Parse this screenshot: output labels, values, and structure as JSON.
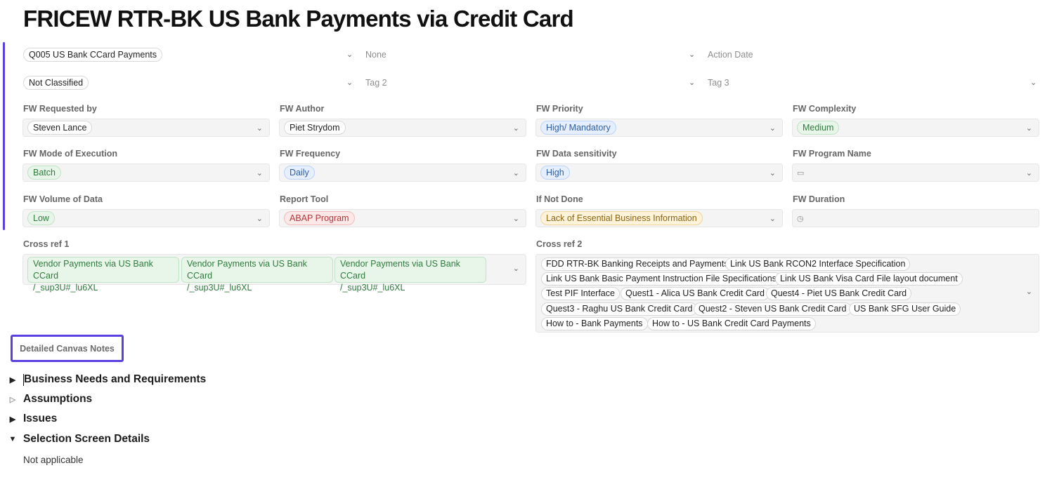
{
  "page": {
    "title": "FRICEW RTR-BK US Bank Payments via Credit Card"
  },
  "top_selects": {
    "row1": [
      {
        "value": "Q005 US Bank CCard Payments",
        "kind": "chip"
      },
      {
        "value": "None",
        "kind": "placeholder"
      },
      {
        "value": "Action Date",
        "kind": "placeholder"
      }
    ],
    "row2": [
      {
        "value": "Not Classified",
        "kind": "chip"
      },
      {
        "value": "Tag 2",
        "kind": "placeholder"
      },
      {
        "value": "Tag 3",
        "kind": "placeholder"
      }
    ]
  },
  "fields": {
    "requested_by": {
      "label": "FW Requested by",
      "value": "Steven Lance"
    },
    "author": {
      "label": "FW Author",
      "value": "Piet Strydom"
    },
    "priority": {
      "label": "FW Priority",
      "value": "High/ Mandatory"
    },
    "complexity": {
      "label": "FW Complexity",
      "value": "Medium"
    },
    "mode": {
      "label": "FW Mode of Execution",
      "value": "Batch"
    },
    "frequency": {
      "label": "FW Frequency",
      "value": "Daily"
    },
    "sensitivity": {
      "label": "FW Data sensitivity",
      "value": "High"
    },
    "program_name": {
      "label": "FW Program Name",
      "value": ""
    },
    "volume": {
      "label": "FW Volume of Data",
      "value": "Low"
    },
    "report_tool": {
      "label": "Report Tool",
      "value": "ABAP Program"
    },
    "if_not_done": {
      "label": "If Not Done",
      "value": "Lack of Essential Business Information"
    },
    "duration": {
      "label": "FW Duration",
      "value": ""
    }
  },
  "cross_ref1": {
    "label": "Cross ref 1",
    "items": [
      {
        "line1": "Vendor Payments via US Bank CCard",
        "line2": "/_sup3U#_lu6XL"
      },
      {
        "line1": "Vendor Payments via US Bank CCard",
        "line2": "/_sup3U#_lu6XL"
      },
      {
        "line1": "Vendor Payments via US Bank CCard",
        "line2": "/_sup3U#_lu6XL"
      }
    ]
  },
  "cross_ref2": {
    "label": "Cross ref 2",
    "items": [
      "FDD RTR-BK Banking Receipts and Payments",
      "Link US Bank RCON2 Interface Specification",
      "Link US Bank Basic Payment Instruction File Specifications",
      "Link US Bank Visa Card File layout document",
      "Test PIF Interface",
      "Quest1 - Alica US Bank Credit Card",
      "Quest4 - Piet US Bank Credit Card",
      "Quest3 - Raghu US Bank Credit Card",
      "Quest2 - Steven US Bank Credit Card",
      "US Bank SFG User Guide",
      "How to - Bank Payments",
      "How to - US Bank Credit Card Payments"
    ]
  },
  "notes_button": "Detailed Canvas Notes",
  "sections": [
    {
      "title": "Business Needs and Requirements",
      "state": "collapsed"
    },
    {
      "title": "Assumptions",
      "state": "empty"
    },
    {
      "title": "Issues",
      "state": "collapsed"
    },
    {
      "title": "Selection Screen Details",
      "state": "expanded"
    }
  ],
  "selection_body": "Not applicable",
  "colors": {
    "accent": "#5b3fe0",
    "chip_green": "#e8f6ea",
    "chip_blue": "#e5efff",
    "chip_red": "#fde8e8",
    "chip_yellow": "#fff3d9"
  }
}
